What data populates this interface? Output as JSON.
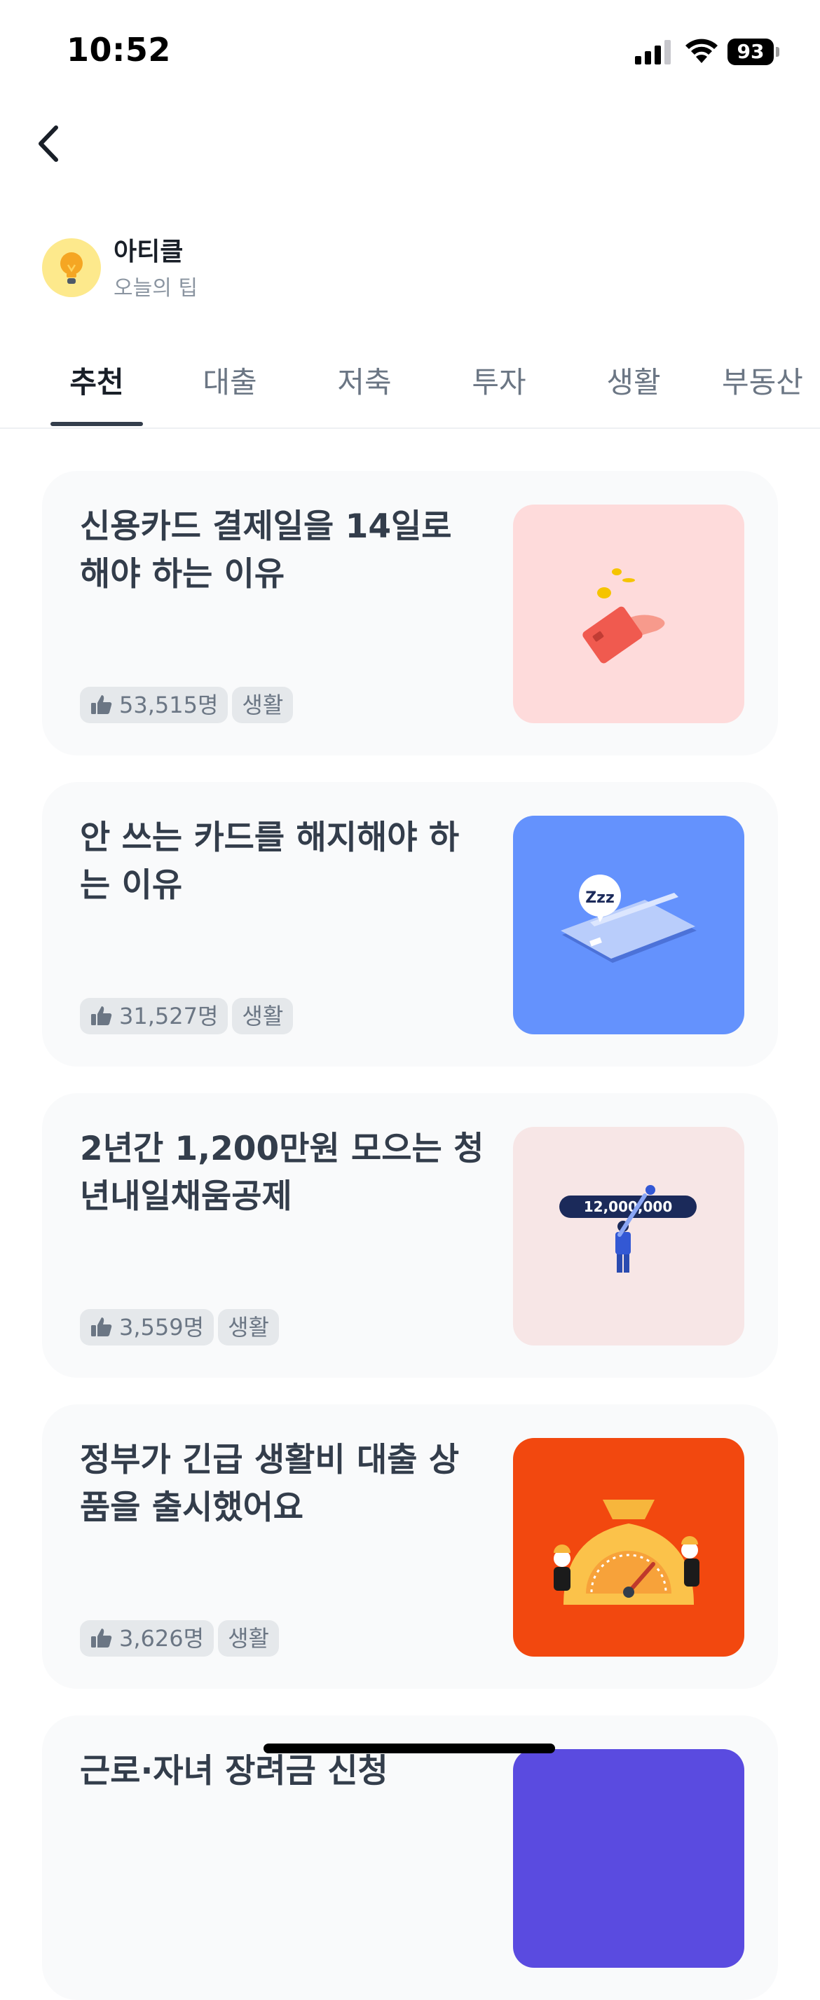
{
  "status_bar": {
    "time": "10:52",
    "battery": "93",
    "icons": [
      "signal-icon",
      "wifi-icon",
      "battery-icon"
    ]
  },
  "nav": {
    "back_icon": "chevron-left-icon"
  },
  "category": {
    "title": "아티클",
    "subtitle": "오늘의 팁",
    "icon": "lightbulb-icon"
  },
  "tabs": [
    {
      "label": "추천",
      "active": true
    },
    {
      "label": "대출",
      "active": false
    },
    {
      "label": "저축",
      "active": false
    },
    {
      "label": "투자",
      "active": false
    },
    {
      "label": "생활",
      "active": false
    },
    {
      "label": "부동산",
      "active": false
    }
  ],
  "articles": [
    {
      "title": "신용카드 결제일을 14일로 해야 하는 이유",
      "likes": "53,515명",
      "tag": "생활",
      "image_bg": "#fedbdb",
      "image_icon": "credit-card-hand-illustration"
    },
    {
      "title": "안 쓰는 카드를 해지해야 하는 이유",
      "likes": "31,527명",
      "tag": "생활",
      "image_bg": "#6492fd",
      "image_icon": "sleeping-card-illustration",
      "image_text": "Zzz"
    },
    {
      "title": "2년간 1,200만원 모으는 청년내일채움공제",
      "likes": "3,559명",
      "tag": "생활",
      "image_bg": "#f7e6e6",
      "image_icon": "savings-bar-illustration",
      "image_text": "12,000,000"
    },
    {
      "title": "정부가 긴급 생활비 대출 상품을 출시했어요",
      "likes": "3,626명",
      "tag": "생활",
      "image_bg": "#f2480f",
      "image_icon": "money-bag-gauge-illustration"
    },
    {
      "title": "근로·자녀 장려금 신청",
      "image_bg": "#5a4be0"
    }
  ],
  "colors": {
    "text_primary": "#191f28",
    "text_card": "#333d4b",
    "text_secondary": "#8b95a1",
    "card_bg": "#f9fafb",
    "pill_bg": "#e5e8eb"
  }
}
